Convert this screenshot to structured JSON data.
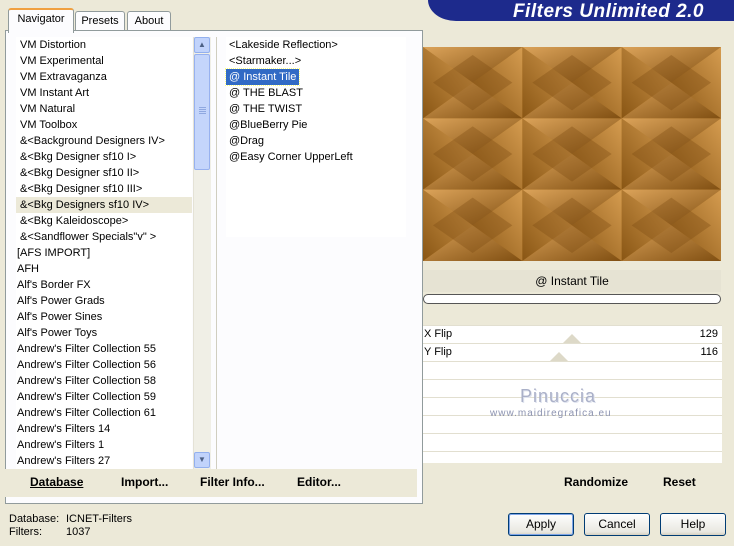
{
  "tabs": [
    {
      "label": "Navigator",
      "active": true
    },
    {
      "label": "Presets",
      "active": false
    },
    {
      "label": "About",
      "active": false
    }
  ],
  "banner": {
    "title": "Filters Unlimited 2.0"
  },
  "categories": [
    "VM Distortion",
    "VM Experimental",
    "VM Extravaganza",
    "VM Instant Art",
    "VM Natural",
    "VM Toolbox",
    "&<Background Designers IV>",
    "&<Bkg Designer sf10 I>",
    "&<Bkg Designer sf10 II>",
    "&<Bkg Designer sf10 III>",
    "&<Bkg Designers sf10 IV>",
    "&<Bkg Kaleidoscope>",
    "&<Sandflower Specials\"v\" >",
    "[AFS IMPORT]",
    "AFH",
    "Alf's Border FX",
    "Alf's Power Grads",
    "Alf's Power Sines",
    "Alf's Power Toys",
    "Andrew's Filter Collection 55",
    "Andrew's Filter Collection 56",
    "Andrew's Filter Collection 58",
    "Andrew's Filter Collection 59",
    "Andrew's Filter Collection 61",
    "Andrew's Filters 14",
    "Andrew's Filters 1",
    "Andrew's Filters 27"
  ],
  "selected_category": "&<Bkg Designers sf10 IV>",
  "filters": [
    "<Lakeside Reflection>",
    "<Starmaker...>",
    "@ Instant Tile",
    "@ THE BLAST",
    "@ THE TWIST",
    "@BlueBerry Pie",
    "@Drag",
    "@Easy Corner UpperLeft"
  ],
  "selected_filter": "@ Instant Tile",
  "toolbar": {
    "database": "Database",
    "import": "Import...",
    "filter_info": "Filter Info...",
    "editor": "Editor..."
  },
  "preview": {
    "filter_name": "@ Instant Tile",
    "colors": {
      "dark": "#7a4a10",
      "mid": "#b5781f",
      "light": "#e0a860"
    }
  },
  "params": [
    {
      "label": "X Flip",
      "value": "129"
    },
    {
      "label": "Y Flip",
      "value": "116"
    }
  ],
  "watermark": {
    "title": "Pinuccia",
    "url": "www.maidiregrafica.eu"
  },
  "right_toolbar": {
    "randomize": "Randomize",
    "reset": "Reset"
  },
  "footer": {
    "database_label": "Database:",
    "database_value": "ICNET-Filters",
    "filters_label": "Filters:",
    "filters_value": "1037"
  },
  "buttons": {
    "apply": "Apply",
    "cancel": "Cancel",
    "help": "Help"
  },
  "scrollbar_arrows": {
    "up": "▲",
    "down": "▼"
  }
}
